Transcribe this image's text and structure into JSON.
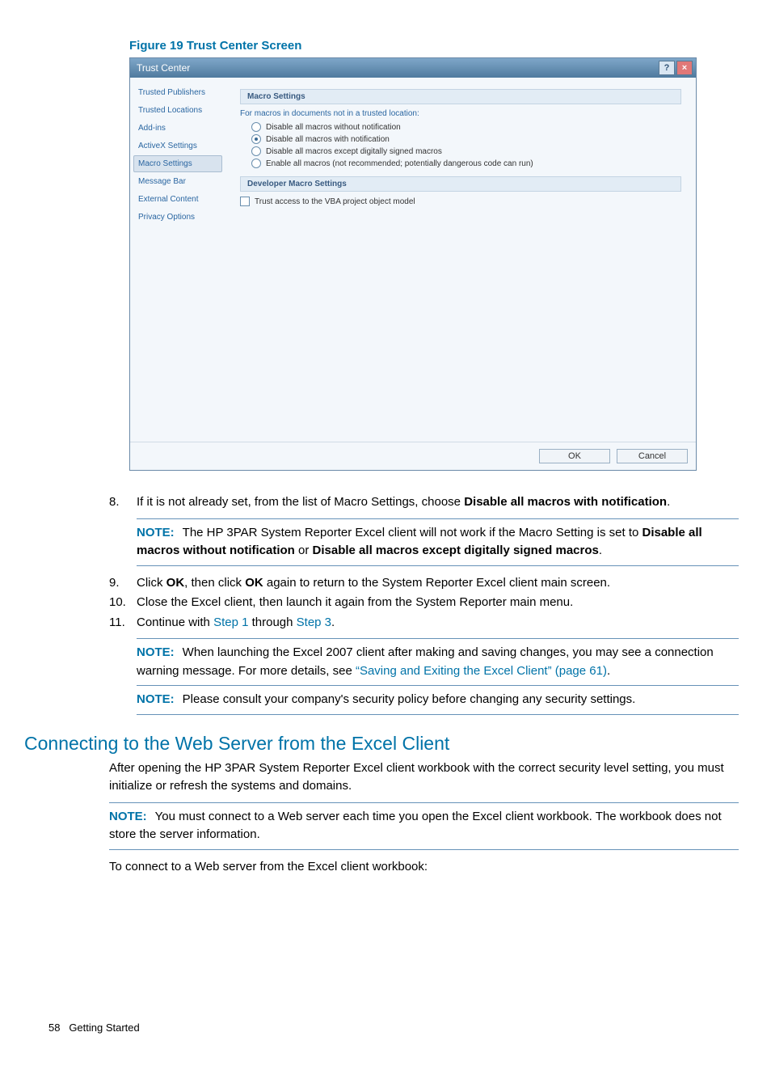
{
  "figure_caption": "Figure 19 Trust Center Screen",
  "dialog": {
    "title": "Trust Center",
    "help_btn": "?",
    "close_btn": "×",
    "sidebar": {
      "items": [
        {
          "label": "Trusted Publishers",
          "selected": false
        },
        {
          "label": "Trusted Locations",
          "selected": false
        },
        {
          "label": "Add-ins",
          "selected": false
        },
        {
          "label": "ActiveX Settings",
          "selected": false
        },
        {
          "label": "Macro Settings",
          "selected": true
        },
        {
          "label": "Message Bar",
          "selected": false
        },
        {
          "label": "External Content",
          "selected": false
        },
        {
          "label": "Privacy Options",
          "selected": false
        }
      ]
    },
    "content": {
      "section1_head": "Macro Settings",
      "group_label": "For macros in documents not in a trusted location:",
      "options": [
        {
          "label": "Disable all macros without notification",
          "checked": false
        },
        {
          "label": "Disable all macros with notification",
          "checked": true
        },
        {
          "label": "Disable all macros except digitally signed macros",
          "checked": false
        },
        {
          "label": "Enable all macros (not recommended; potentially dangerous code can run)",
          "checked": false
        }
      ],
      "section2_head": "Developer Macro Settings",
      "dev_option": {
        "label": "Trust access to the VBA project object model",
        "checked": false
      }
    },
    "footer": {
      "ok": "OK",
      "cancel": "Cancel"
    }
  },
  "steps": {
    "s8": {
      "num": "8.",
      "text_a": "If it is not already set, from the list of Macro Settings, choose ",
      "bold_a": "Disable all macros with notification",
      "text_b": "."
    },
    "note1": {
      "label": "NOTE:",
      "text_a": "The HP 3PAR System Reporter Excel client will not work if the Macro Setting is set to ",
      "bold_a": "Disable all macros without notification",
      "text_b": " or ",
      "bold_b": "Disable all macros except digitally signed macros",
      "text_c": "."
    },
    "s9": {
      "num": "9.",
      "text_a": "Click ",
      "bold_a": "OK",
      "text_b": ", then click ",
      "bold_b": "OK",
      "text_c": " again to return to the System Reporter Excel client main screen."
    },
    "s10": {
      "num": "10.",
      "text": "Close the Excel client, then launch it again from the System Reporter main menu."
    },
    "s11": {
      "num": "11.",
      "text_a": "Continue with ",
      "link_a": "Step 1",
      "text_b": " through ",
      "link_b": "Step 3",
      "text_c": "."
    },
    "note2": {
      "label": "NOTE:",
      "text_a": "When launching the Excel 2007 client after making and saving changes, you may see a connection warning message. For more details, see ",
      "link_a": "“Saving and Exiting the Excel Client” (page 61)",
      "text_b": "."
    },
    "note3": {
      "label": "NOTE:",
      "text": "Please consult your company's security policy before changing any security settings."
    }
  },
  "section": {
    "heading": "Connecting to the Web Server from the Excel Client",
    "p1": "After opening the HP 3PAR System Reporter Excel client workbook with the correct security level setting, you must initialize or refresh the systems and domains.",
    "note": {
      "label": "NOTE:",
      "text": "You must connect to a Web server each time you open the Excel client workbook. The workbook does not store the server information."
    },
    "p2": "To connect to a Web server from the Excel client workbook:"
  },
  "footer": {
    "pagenum": "58",
    "section": "Getting Started"
  }
}
